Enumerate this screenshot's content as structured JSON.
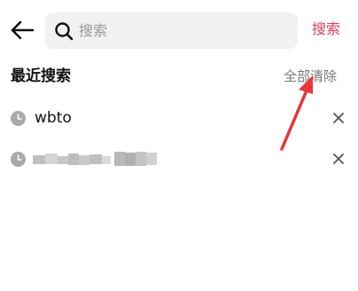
{
  "search": {
    "placeholder": "搜索",
    "value": "",
    "submit_label": "搜索"
  },
  "history": {
    "title": "最近搜索",
    "clear_all_label": "全部清除",
    "items": [
      {
        "text": "wbto",
        "blurred": false
      },
      {
        "text": "",
        "blurred": true
      }
    ]
  },
  "colors": {
    "accent": "#e23d5b",
    "annotation": "#e8363a",
    "search_bg": "#f1f1f1",
    "icon_gray": "#aaaaaa"
  },
  "icons": {
    "back": "arrow-left-icon",
    "search": "search-icon",
    "history": "clock-icon",
    "remove": "close-icon"
  }
}
